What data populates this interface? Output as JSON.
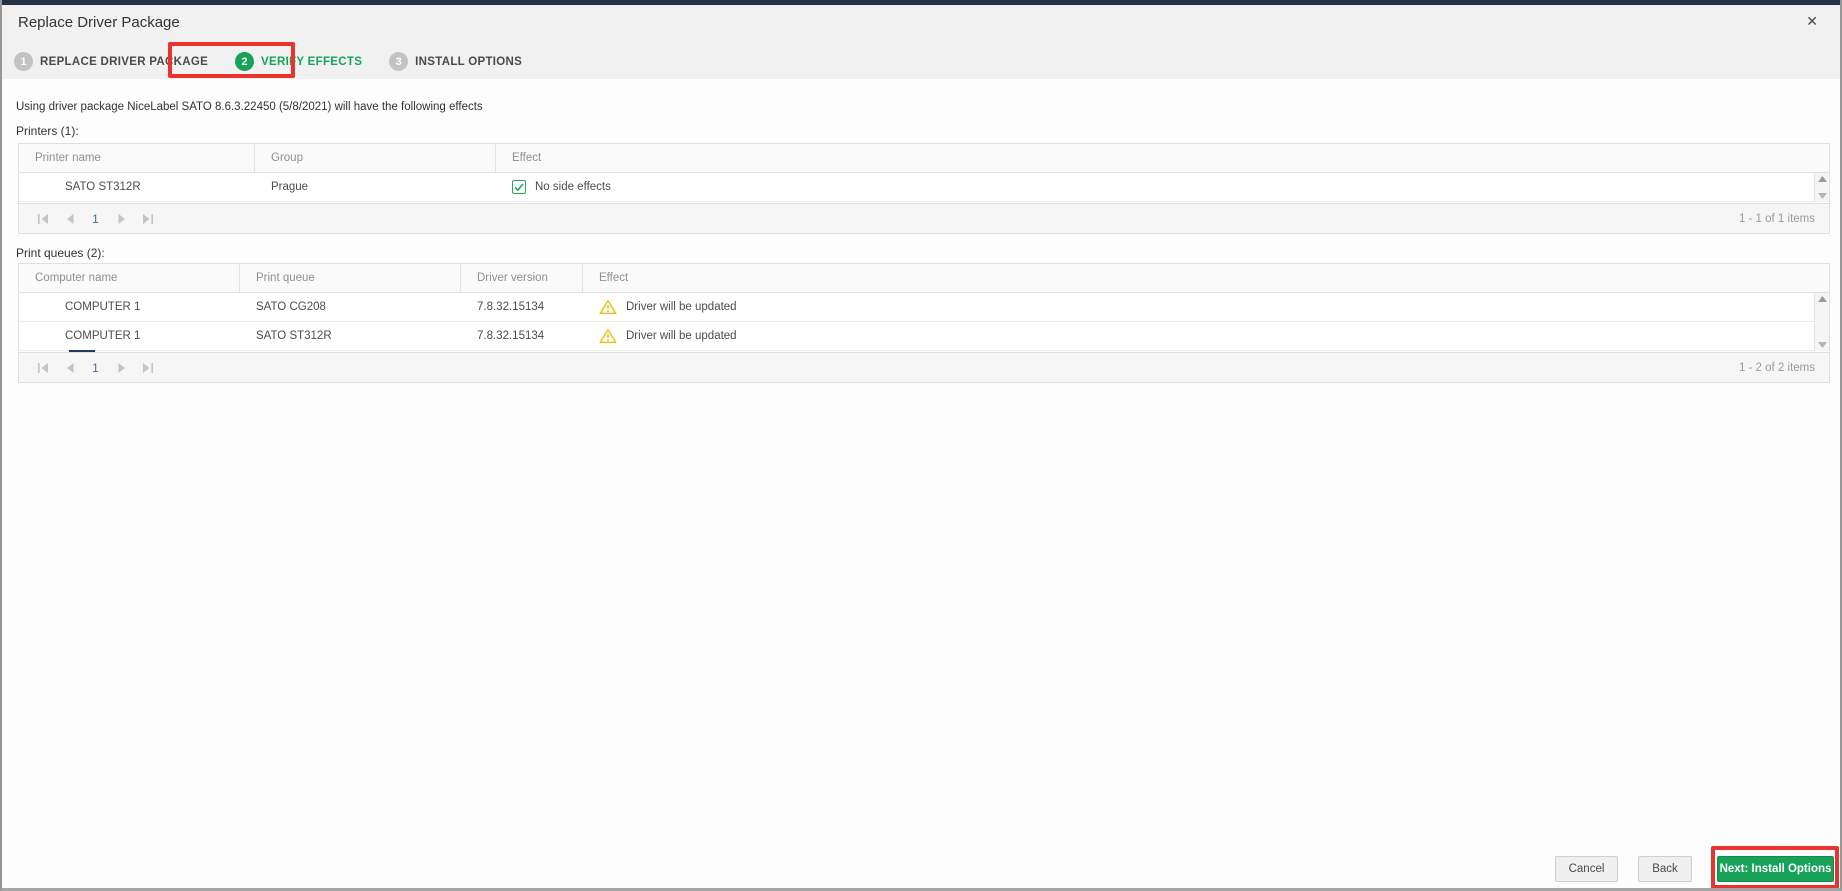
{
  "dialog": {
    "title": "Replace Driver Package",
    "close_icon": "✕"
  },
  "steps": [
    {
      "number": "1",
      "label": "REPLACE DRIVER PACKAGE",
      "state": "completed"
    },
    {
      "number": "2",
      "label": "VERIFY EFFECTS",
      "state": "active"
    },
    {
      "number": "3",
      "label": "INSTALL OPTIONS",
      "state": "upcoming"
    }
  ],
  "intro_text": "Using driver package NiceLabel SATO 8.6.3.22450 (5/8/2021) will have the following effects",
  "printers": {
    "label": "Printers (1):",
    "columns": {
      "c1": "Printer name",
      "c2": "Group",
      "c3": "Effect"
    },
    "rows": [
      {
        "printer_name": "SATO ST312R",
        "group": "Prague",
        "effect": "No side effects",
        "effect_icon": "green-checkbox"
      }
    ],
    "pager": {
      "current_page": "1",
      "summary": "1 - 1 of 1 items"
    }
  },
  "print_queues": {
    "label": "Print queues (2):",
    "columns": {
      "c1": "Computer name",
      "c2": "Print queue",
      "c3": "Driver version",
      "c4": "Effect"
    },
    "rows": [
      {
        "computer_name": "COMPUTER 1",
        "print_queue": "SATO CG208",
        "driver_version": "7.8.32.15134",
        "effect": "Driver will be updated",
        "effect_icon": "warning-triangle"
      },
      {
        "computer_name": "COMPUTER 1",
        "print_queue": "SATO ST312R",
        "driver_version": "7.8.32.15134",
        "effect": "Driver will be updated",
        "effect_icon": "warning-triangle"
      }
    ],
    "pager": {
      "current_page": "1",
      "summary": "1 - 2 of 2 items"
    }
  },
  "pager_icons": [
    "first-page",
    "previous-page",
    "next-page",
    "last-page"
  ],
  "footer": {
    "cancel_label": "Cancel",
    "back_label": "Back",
    "next_label": "Next: Install Options"
  },
  "colors": {
    "accent_green": "#17A258",
    "annotation_red": "#E7342F",
    "warning_yellow": "#EEC11E",
    "pager_blue": "#4A6D9C",
    "header_gray": "#F1F1F2"
  }
}
